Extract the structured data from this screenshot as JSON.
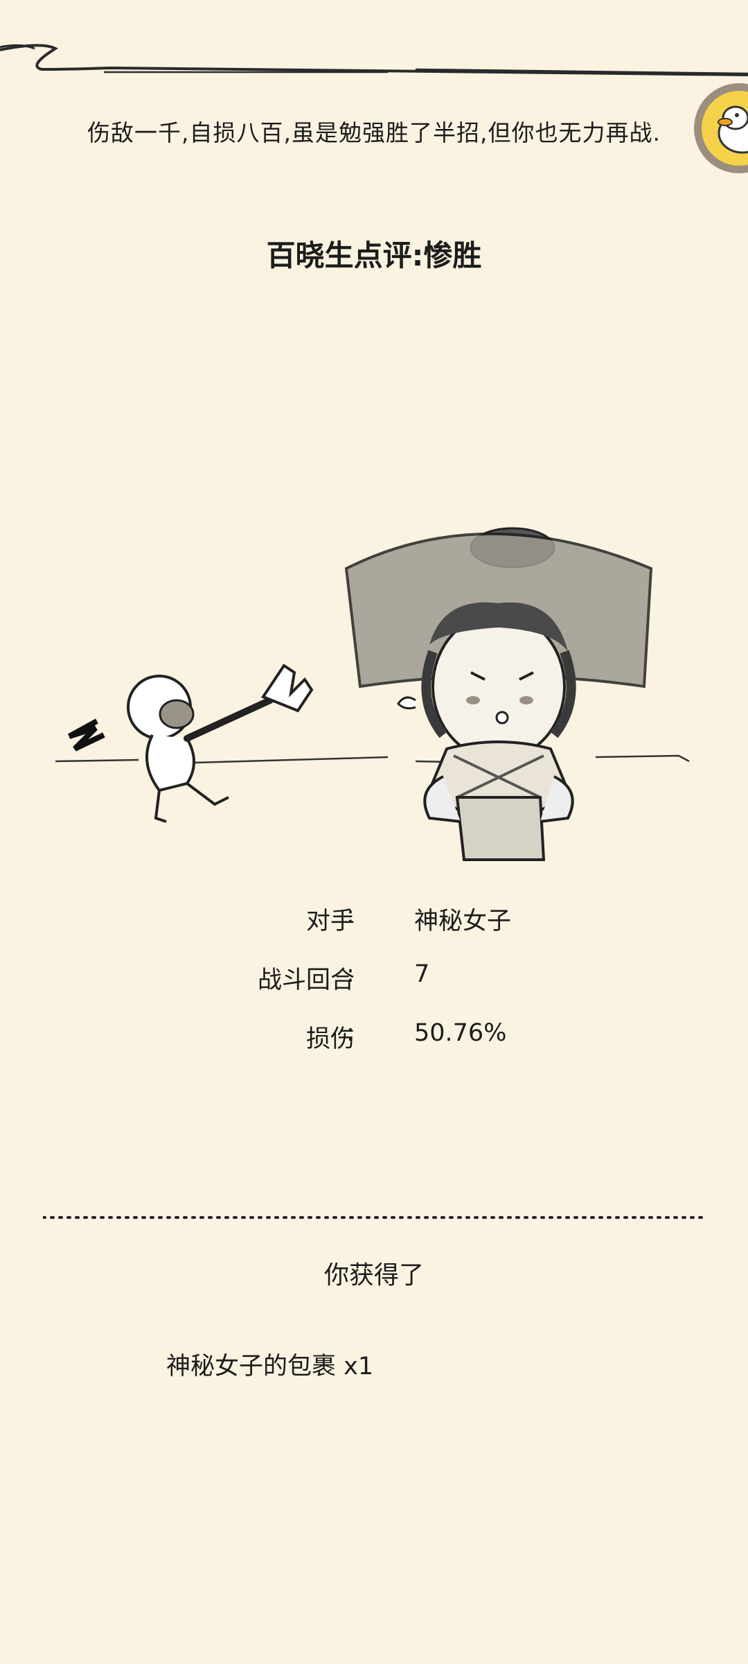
{
  "result": {
    "message": "伤敌一千,自损八百,虽是勉强胜了半招,但你也无力再战.",
    "rating": "百晓生点评:惨胜"
  },
  "stats": [
    {
      "label": "对手",
      "value": "神秘女子"
    },
    {
      "label": "战斗回合",
      "value": "7"
    },
    {
      "label": "损伤",
      "value": "50.76%"
    }
  ],
  "stat_colon": ":",
  "reward": {
    "heading": "你获得了",
    "items": [
      {
        "name": "神秘女子的包裹",
        "quantity": "x1"
      }
    ]
  },
  "icons": {
    "avatar": "duck-avatar-icon",
    "illustration": "battle-scene-illustration"
  },
  "colors": {
    "background": "#fbf3e2",
    "text": "#1c1c1c",
    "avatar_ring": "#9b8e7c",
    "avatar_fill": "#f6d24a"
  }
}
